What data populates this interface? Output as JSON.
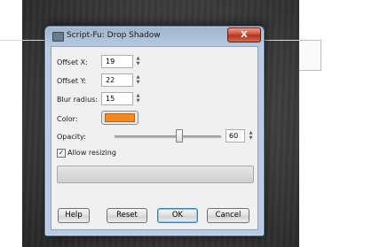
{
  "dialog": {
    "title": "Script-Fu: Drop Shadow",
    "close_symbol": "X",
    "offset_x": {
      "label": "Offset X:",
      "value": "19"
    },
    "offset_y": {
      "label": "Offset Y:",
      "value": "22"
    },
    "blur_radius": {
      "label": "Blur radius:",
      "value": "15"
    },
    "color": {
      "label": "Color:",
      "swatch": "#f08a20"
    },
    "opacity": {
      "label": "Opacity:",
      "value": "60",
      "level_percent": 60
    },
    "allow_resizing": {
      "label": "Allow resizing",
      "checked": true,
      "check_glyph": "✓"
    },
    "buttons": {
      "help": "Help",
      "reset": "Reset",
      "ok": "OK",
      "cancel": "Cancel"
    }
  },
  "spin_arrows": {
    "up": "▲",
    "down": "▼"
  }
}
